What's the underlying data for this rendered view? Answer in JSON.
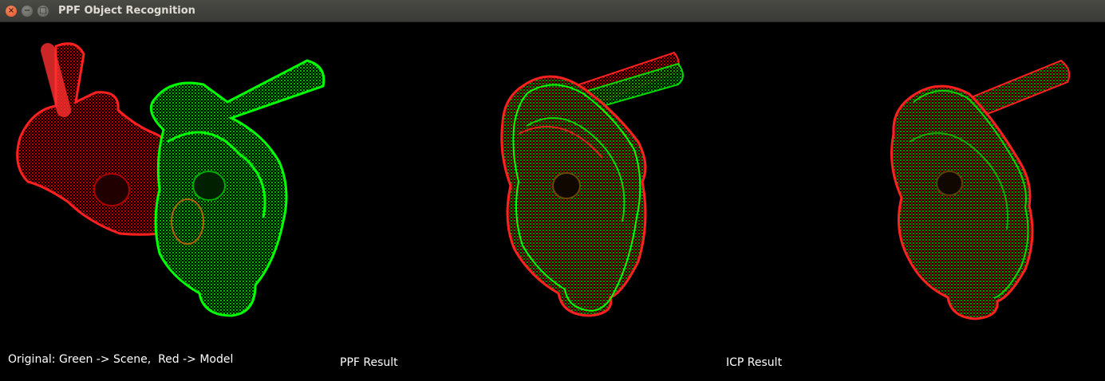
{
  "window": {
    "title": "PPF Object Recognition",
    "buttons": {
      "close": "×",
      "minimize": "−",
      "maximize": "□"
    }
  },
  "captions": {
    "original": "Original: Green -> Scene,  Red -> Model",
    "ppf": "PPF Result",
    "icp": "ICP Result"
  },
  "colors": {
    "scene": "#00ff00",
    "model": "#ff0000",
    "background": "#000000",
    "overlap": "#8a7a10"
  }
}
